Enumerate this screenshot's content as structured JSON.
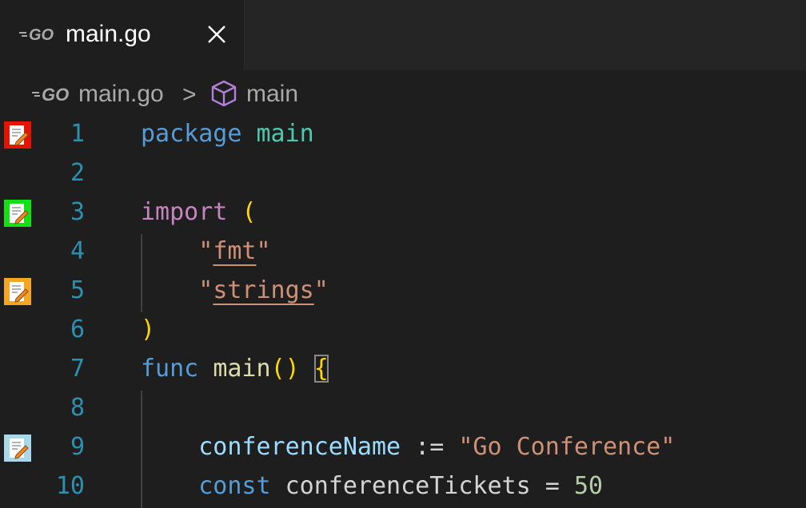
{
  "tab": {
    "label": "main.go",
    "icon": "go-file-icon",
    "close_icon": "close-icon"
  },
  "breadcrumb": {
    "file": "main.go",
    "separator": ">",
    "symbol": "main",
    "symbol_icon": "symbol-module-icon"
  },
  "gutter": {
    "line_1": {
      "icon": "edit-marker-icon",
      "color": "#e51400"
    },
    "line_3": {
      "icon": "edit-marker-icon",
      "color": "#14e014"
    },
    "line_5": {
      "icon": "edit-marker-icon",
      "color": "#f5a623"
    },
    "line_9": {
      "icon": "edit-marker-icon",
      "color": "#a8d8ea"
    }
  },
  "lines": [
    {
      "num": "1",
      "tokens": [
        "package",
        " ",
        "main"
      ]
    },
    {
      "num": "2",
      "tokens": []
    },
    {
      "num": "3",
      "tokens": [
        "import",
        " ",
        "("
      ]
    },
    {
      "num": "4",
      "tokens": [
        "    ",
        "\"",
        "fmt",
        "\""
      ]
    },
    {
      "num": "5",
      "tokens": [
        "    ",
        "\"",
        "strings",
        "\""
      ]
    },
    {
      "num": "6",
      "tokens": [
        ")"
      ]
    },
    {
      "num": "7",
      "tokens": [
        "func",
        " ",
        "main",
        "()",
        " ",
        "{"
      ]
    },
    {
      "num": "8",
      "tokens": []
    },
    {
      "num": "9",
      "tokens": [
        "    ",
        "conferenceName",
        " := ",
        "\"Go Conference\""
      ]
    },
    {
      "num": "10",
      "tokens": [
        "    ",
        "const",
        " ",
        "conferenceTickets",
        " = ",
        "50"
      ]
    }
  ],
  "colors": {
    "background": "#1e1e1e",
    "line_number": "#2b91af",
    "keyword_blue": "#569cd6",
    "keyword_purple": "#c586c0",
    "string": "#ce9178",
    "function": "#dcdcaa",
    "variable": "#9cdcfe",
    "number": "#b5cea8",
    "bracket": "#ffd700"
  }
}
